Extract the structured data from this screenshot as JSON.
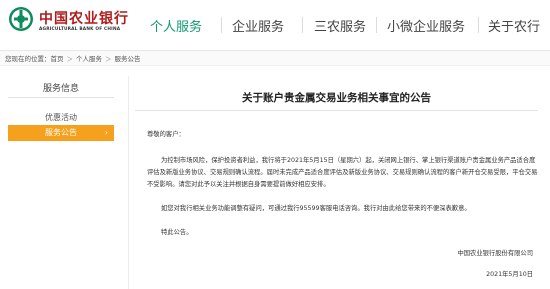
{
  "header": {
    "logo_cn": "中国农业银行",
    "logo_en": "AGRICULTURAL BANK OF CHINA",
    "nav": [
      {
        "label": "个人服务",
        "active": true
      },
      {
        "label": "企业服务",
        "active": false
      },
      {
        "label": "三农服务",
        "active": false
      },
      {
        "label": "小微企业服务",
        "active": false
      },
      {
        "label": "关于农行",
        "active": false
      }
    ]
  },
  "breadcrumb": {
    "prefix": "您现在的位置：",
    "items": [
      "首页",
      "个人服务",
      "服务公告"
    ],
    "separator": "＞"
  },
  "sidebar": {
    "title": "服务信息",
    "items": [
      {
        "label": "优惠活动",
        "active": false
      },
      {
        "label": "服务公告",
        "active": true
      }
    ],
    "active_chevron": "›"
  },
  "article": {
    "title": "关于账户贵金属交易业务相关事宜的公告",
    "salutation": "尊敬的客户：",
    "paragraphs": [
      "为控制市场风险，保护投资者利益，我行将于2021年5月15日（星期六）起，关闭网上银行、掌上银行渠道账户贵金属业务产品适合度评估及新版业务协议、交易规则确认流程。届时未完成产品适合度评估及新版业务协议、交易规则确认流程的客户新开仓交易受限，平仓交易不受影响。请您对此予以关注并根据自身需要提前做好相应安排。",
      "如您对我行相关业务功能调整有疑问，可通过我行95599客服电话咨询。我行对由此给您带来的不便深表歉意。",
      "特此公告。"
    ],
    "signature_org": "中国农业银行股份有限公司",
    "signature_date": "2021年5月10日"
  },
  "colors": {
    "brand_red": "#b01c1c",
    "nav_active": "#0f9a6f",
    "sidebar_active": "#f5a11e"
  }
}
